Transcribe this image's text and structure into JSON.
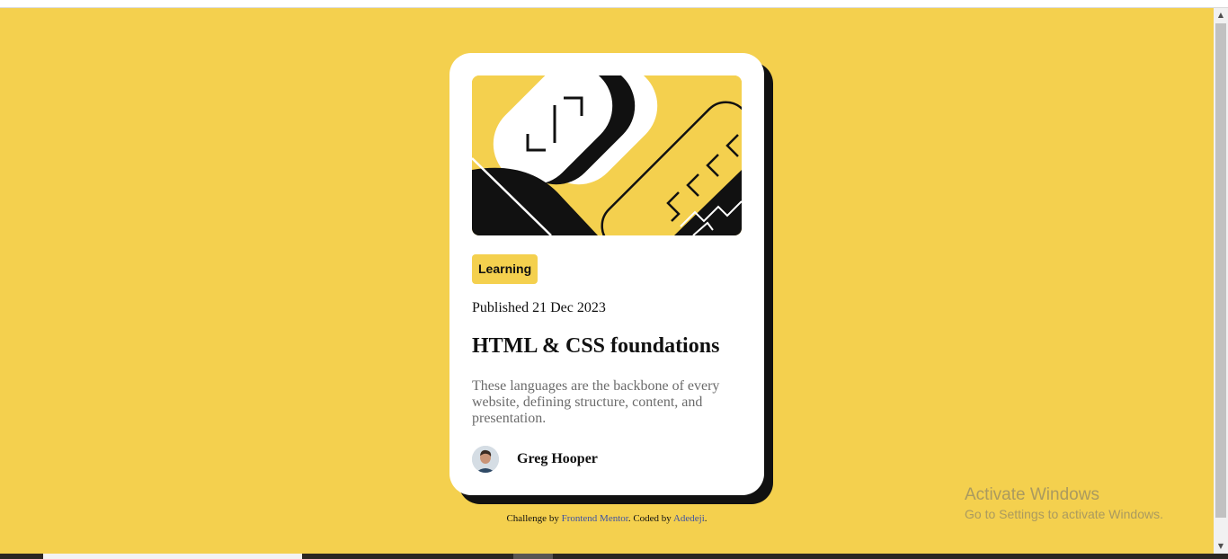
{
  "card": {
    "tag": "Learning",
    "published": "Published 21 Dec 2023",
    "title": "HTML & CSS foundations",
    "description": "These languages are the backbone of every website, defining structure, content, and presentation.",
    "author": "Greg Hooper"
  },
  "footer": {
    "prefix": "Challenge by ",
    "link1": "Frontend Mentor",
    "middle": ". Coded by ",
    "link2": "Adedeji",
    "suffix": "."
  },
  "watermark": {
    "title": "Activate Windows",
    "subtitle": "Go to Settings to activate Windows."
  },
  "colors": {
    "background": "#f4d04e",
    "card": "#ffffff",
    "shadow": "#111111",
    "link": "#3e52a3"
  }
}
